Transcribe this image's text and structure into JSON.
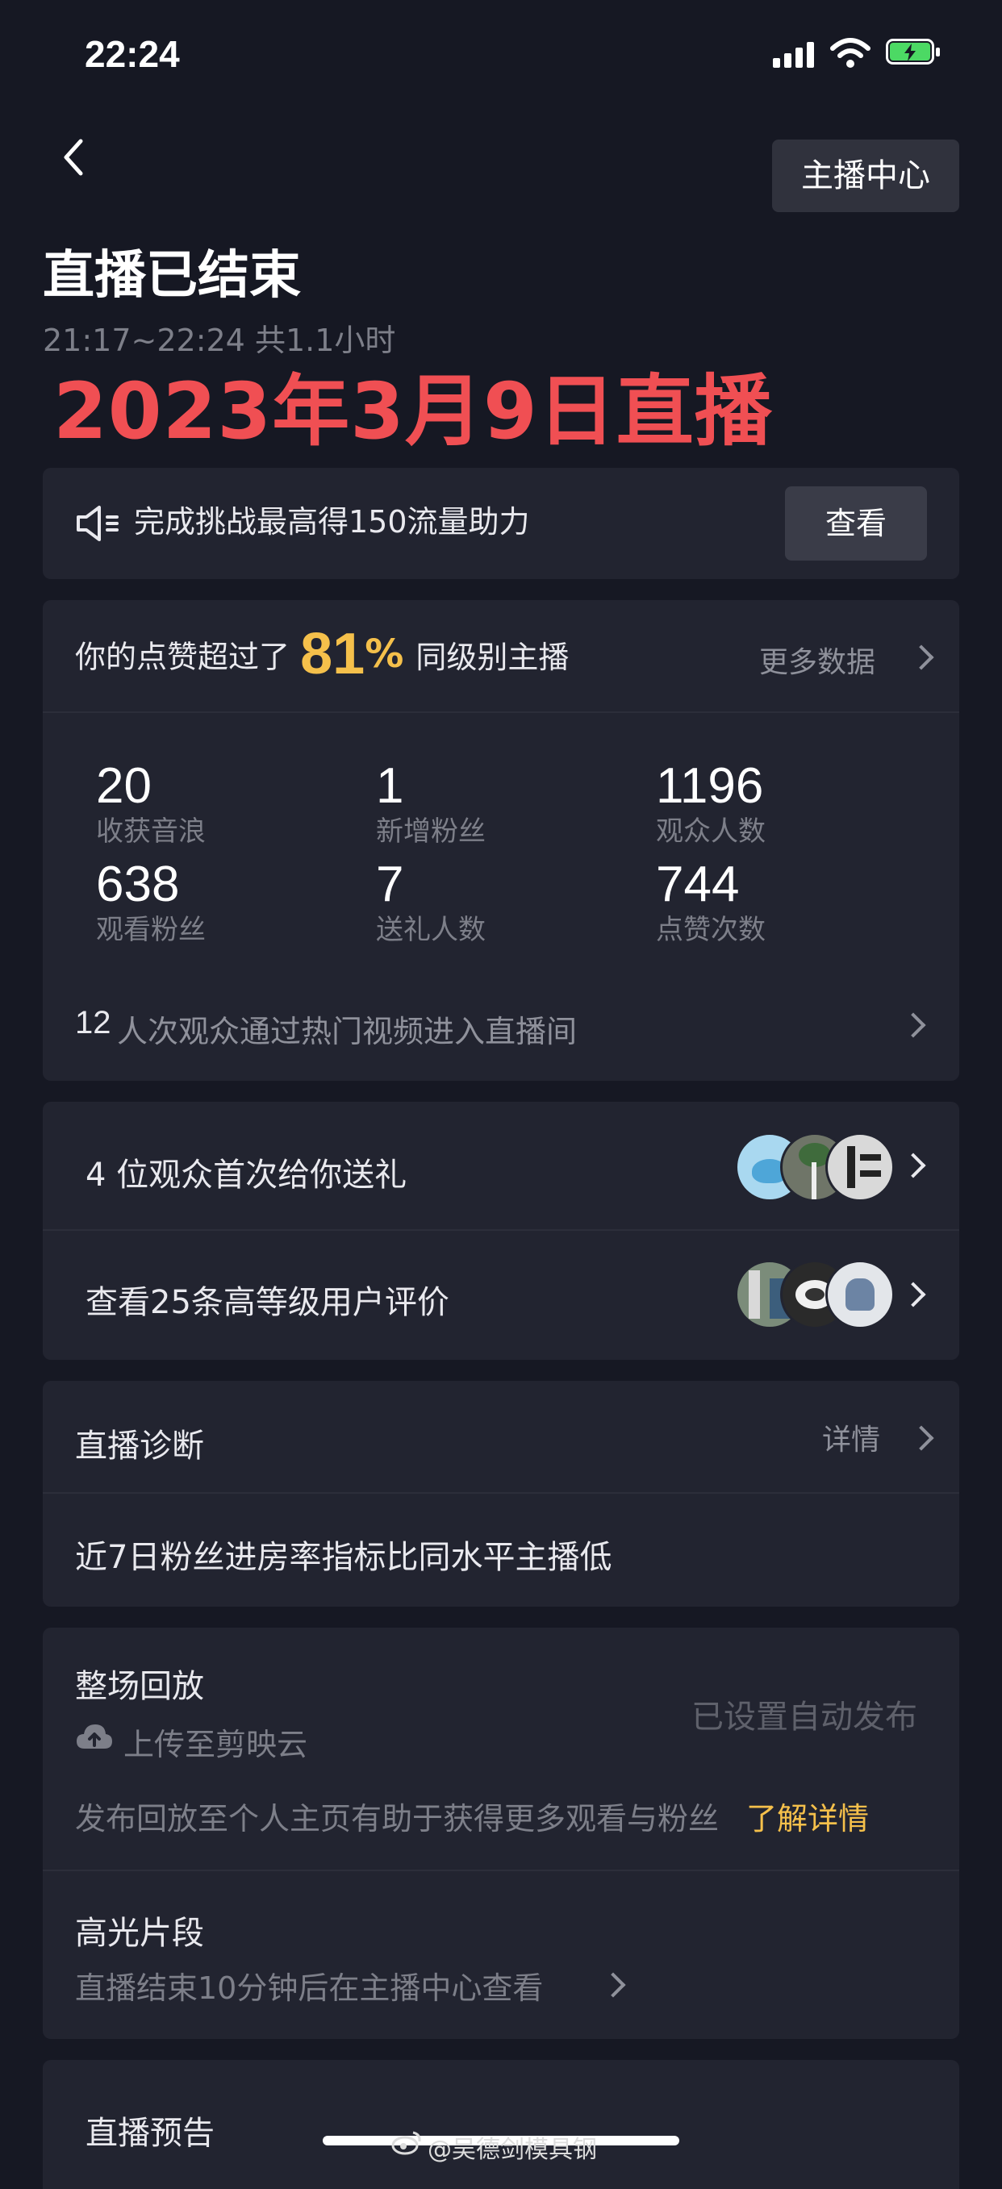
{
  "colors": {
    "background": "#161823",
    "card": "#222430",
    "accent": "#f5c04b",
    "headline_red": "#f04f53",
    "muted": "#7d7f89"
  },
  "status_bar": {
    "time": "22:24"
  },
  "nav": {
    "back_icon": "chevron-left-icon",
    "center_button": "主播中心"
  },
  "header": {
    "title": "直播已结束",
    "subtitle": "21:17~22:24 共1.1小时",
    "overlay_text": "2023年3月9日直播"
  },
  "challenge": {
    "text": "完成挑战最高得150流量助力",
    "button": "查看"
  },
  "likes": {
    "prefix": "你的点赞超过了",
    "percent": "81",
    "percent_sign": "%",
    "suffix": "同级别主播",
    "more": "更多数据",
    "stats": [
      {
        "value": "20",
        "label": "收获音浪"
      },
      {
        "value": "1",
        "label": "新增粉丝"
      },
      {
        "value": "1196",
        "label": "观众人数"
      },
      {
        "value": "638",
        "label": "观看粉丝"
      },
      {
        "value": "7",
        "label": "送礼人数"
      },
      {
        "value": "744",
        "label": "点赞次数"
      }
    ],
    "traffic_count": "12",
    "traffic_text": "人次观众通过热门视频进入直播间"
  },
  "gifts": {
    "first_gift": "4 位观众首次给你送礼",
    "reviews": "查看25条高等级用户评价"
  },
  "diagnosis": {
    "title": "直播诊断",
    "detail": "详情",
    "message": "近7日粉丝进房率指标比同水平主播低"
  },
  "replay": {
    "title": "整场回放",
    "upload": "上传至剪映云",
    "status": "已设置自动发布",
    "desc": "发布回放至个人主页有助于获得更多观看与粉丝",
    "learn_more": "了解详情",
    "highlights_title": "高光片段",
    "highlights_desc": "直播结束10分钟后在主播中心查看"
  },
  "preview": {
    "title": "直播预告"
  },
  "watermark": "@吴德剑模具钢"
}
